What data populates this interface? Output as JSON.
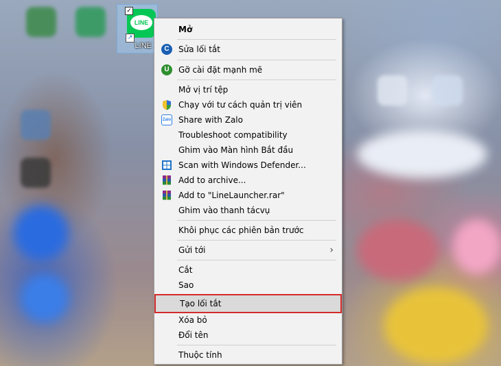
{
  "desktop": {
    "shortcut": {
      "label": "LINE",
      "logo_text": "LINE",
      "checked": true
    }
  },
  "menu": {
    "items": [
      {
        "label": "Mở",
        "icon": "none",
        "bold": true
      },
      {
        "label": "Sửa lối tắt",
        "icon": "ccleaner-icon"
      },
      {
        "label": "Gỡ cài đặt mạnh mẽ",
        "icon": "iobit-uninstaller-icon"
      },
      {
        "label": "Mở vị trí tệp",
        "icon": "none"
      },
      {
        "label": "Chạy với tư cách quản trị viên",
        "icon": "uac-shield-icon"
      },
      {
        "label": "Share with Zalo",
        "icon": "zalo-icon"
      },
      {
        "label": "Troubleshoot compatibility",
        "icon": "none"
      },
      {
        "label": "Ghim vào Màn hình Bắt đầu",
        "icon": "none"
      },
      {
        "label": "Scan with Windows Defender...",
        "icon": "windows-defender-icon"
      },
      {
        "label": "Add to archive...",
        "icon": "winrar-icon"
      },
      {
        "label": "Add to \"LineLauncher.rar\"",
        "icon": "winrar-icon"
      },
      {
        "label": "Ghim vào thanh tácvụ",
        "icon": "none"
      },
      {
        "label": "Khôi phục các phiên bản trước",
        "icon": "none"
      },
      {
        "label": "Gửi tới",
        "icon": "none",
        "submenu": true
      },
      {
        "label": "Cắt",
        "icon": "none"
      },
      {
        "label": "Sao",
        "icon": "none"
      },
      {
        "label": "Tạo lối tắt",
        "icon": "none",
        "highlighted": true
      },
      {
        "label": "Xóa bỏ",
        "icon": "none"
      },
      {
        "label": "Đổi tên",
        "icon": "none"
      },
      {
        "label": "Thuộc tính",
        "icon": "none"
      }
    ],
    "colors": {
      "background": "#f2f2f2",
      "highlight_border": "#d42a2a",
      "highlight_fill": "#dadada"
    }
  }
}
